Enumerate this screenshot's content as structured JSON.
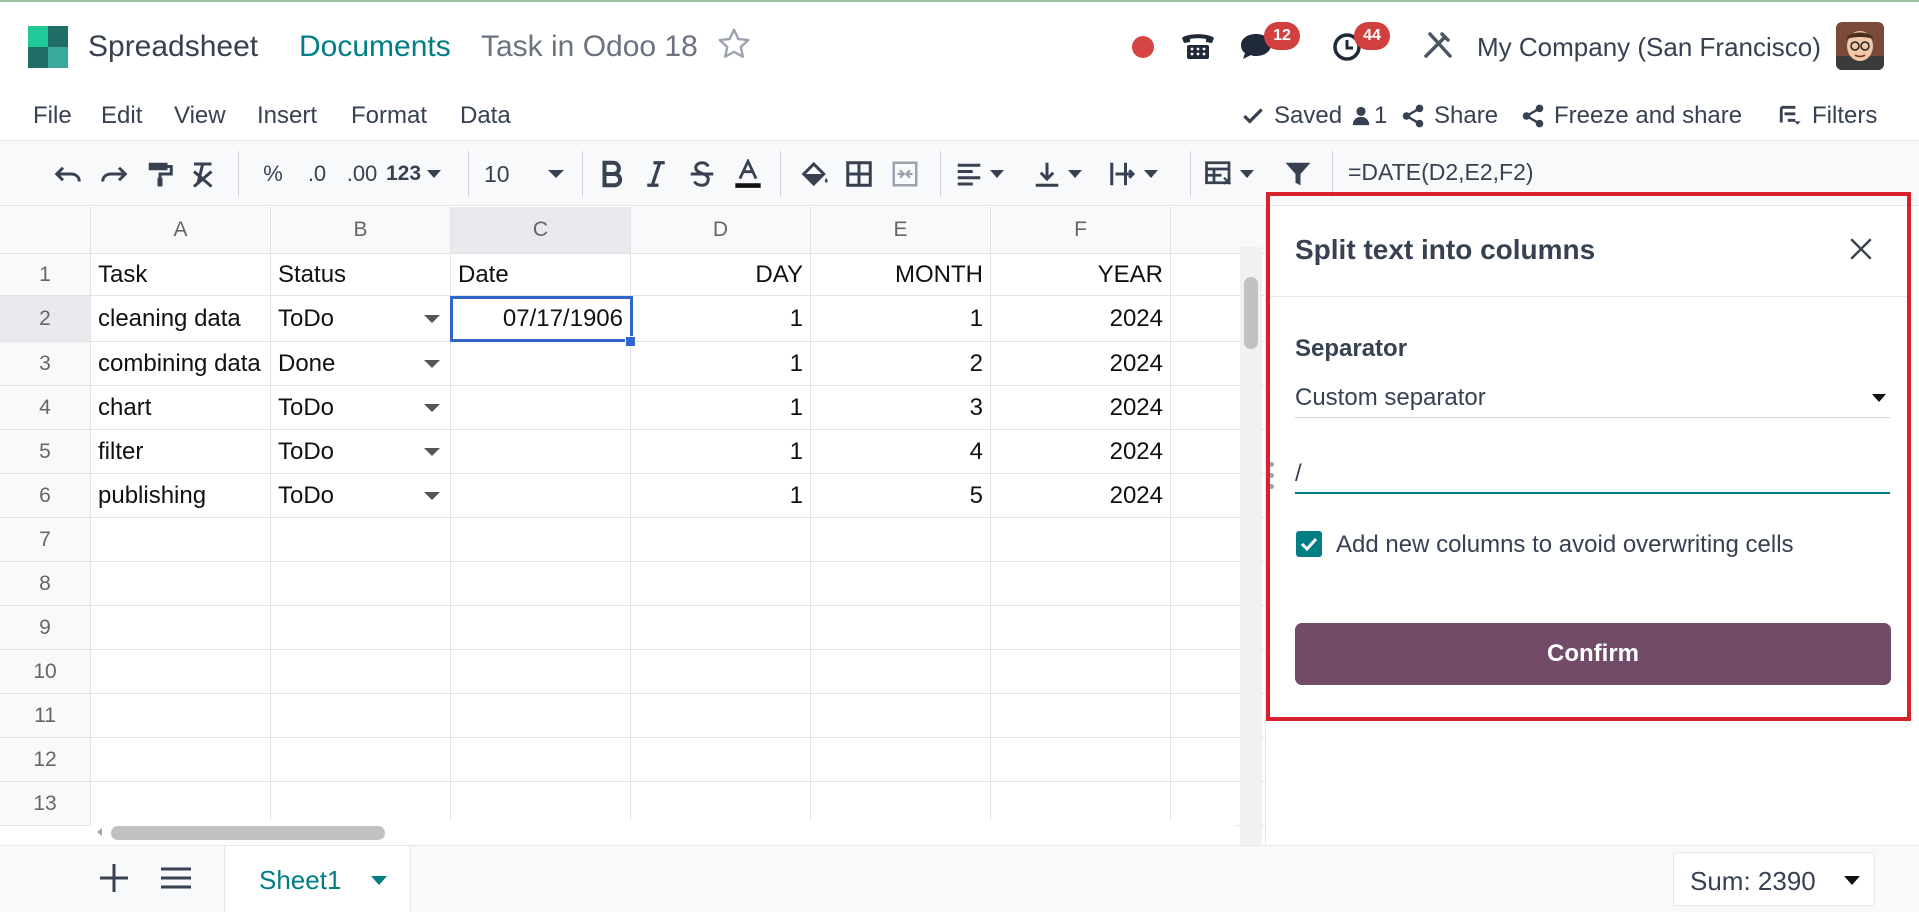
{
  "nav": {
    "app_name": "Spreadsheet",
    "breadcrumb_documents": "Documents",
    "breadcrumb_current": "Task in Odoo 18",
    "messages_count": "12",
    "activities_count": "44",
    "company": "My Company (San Francisco)",
    "icons": [
      "star-icon",
      "recording-dot-icon",
      "phone-icon",
      "chat-icon",
      "clock-icon",
      "tools-icon",
      "avatar"
    ]
  },
  "menu": {
    "items": [
      "File",
      "Edit",
      "View",
      "Insert",
      "Format",
      "Data"
    ],
    "saved": "Saved",
    "users": "1",
    "share": "Share",
    "freeze_share": "Freeze and share",
    "filters": "Filters"
  },
  "toolbar": {
    "percent": "%",
    "dec_decrease": ".0",
    "dec_increase": ".00",
    "number_format": "123",
    "font_size": "10",
    "formula": "=DATE(D2,E2,F2)"
  },
  "grid": {
    "columns": [
      "A",
      "B",
      "C",
      "D",
      "E",
      "F"
    ],
    "selected_column": "C",
    "selected_row": "2",
    "rows": [
      {
        "n": "1",
        "cells": [
          "Task",
          "Status",
          "Date",
          "DAY",
          "MONTH",
          "YEAR"
        ]
      },
      {
        "n": "2",
        "cells": [
          "cleaning data",
          "ToDo",
          "07/17/1906",
          "1",
          "1",
          "2024"
        ]
      },
      {
        "n": "3",
        "cells": [
          "combining data",
          "Done",
          "",
          "1",
          "2",
          "2024"
        ]
      },
      {
        "n": "4",
        "cells": [
          "chart",
          "ToDo",
          "",
          "1",
          "3",
          "2024"
        ]
      },
      {
        "n": "5",
        "cells": [
          "filter",
          "ToDo",
          "",
          "1",
          "4",
          "2024"
        ]
      },
      {
        "n": "6",
        "cells": [
          "publishing",
          "ToDo",
          "",
          "1",
          "5",
          "2024"
        ]
      },
      {
        "n": "7",
        "cells": [
          "",
          "",
          "",
          "",
          "",
          ""
        ]
      },
      {
        "n": "8",
        "cells": [
          "",
          "",
          "",
          "",
          "",
          ""
        ]
      },
      {
        "n": "9",
        "cells": [
          "",
          "",
          "",
          "",
          "",
          ""
        ]
      },
      {
        "n": "10",
        "cells": [
          "",
          "",
          "",
          "",
          "",
          ""
        ]
      },
      {
        "n": "11",
        "cells": [
          "",
          "",
          "",
          "",
          "",
          ""
        ]
      },
      {
        "n": "12",
        "cells": [
          "",
          "",
          "",
          "",
          "",
          ""
        ]
      },
      {
        "n": "13",
        "cells": [
          "",
          "",
          "",
          "",
          "",
          ""
        ]
      }
    ]
  },
  "panel": {
    "title": "Split text into columns",
    "separator_label": "Separator",
    "separator_selected": "Custom separator",
    "custom_value": "/",
    "checkbox_label": "Add new columns to avoid overwriting cells",
    "checkbox_checked": true,
    "confirm": "Confirm"
  },
  "bottom": {
    "sheet_name": "Sheet1",
    "sum": "Sum: 2390"
  },
  "colors": {
    "brand_teal": "#017e84",
    "primary_button": "#714b67",
    "highlight_border": "#d8212c",
    "selection": "#3266ca",
    "badge": "#d23f3f"
  }
}
